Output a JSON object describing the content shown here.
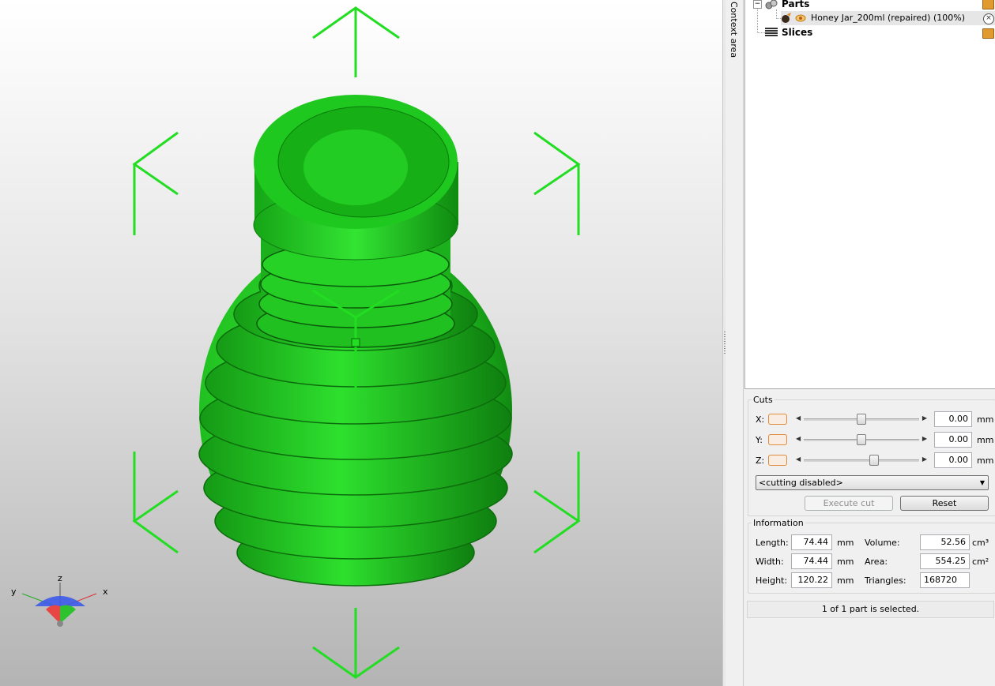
{
  "viewport": {
    "model_color": "#1fc21f",
    "gizmo_color": "#22dd22",
    "axes": {
      "x": "x",
      "y": "y",
      "z": "z"
    }
  },
  "context_area": {
    "label": "Context area"
  },
  "tree": {
    "parts_label": "Parts",
    "part_item": "Honey Jar_200ml (repaired) (100%)",
    "slices_label": "Slices",
    "expander": "−"
  },
  "cuts": {
    "title": "Cuts",
    "rows": [
      {
        "axis": "X:",
        "value": "0.00",
        "unit": "mm",
        "level": 0.5
      },
      {
        "axis": "Y:",
        "value": "0.00",
        "unit": "mm",
        "level": 0.5
      },
      {
        "axis": "Z:",
        "value": "0.00",
        "unit": "mm",
        "level": 0.62
      }
    ],
    "mode": "<cutting disabled>",
    "execute_label": "Execute cut",
    "reset_label": "Reset"
  },
  "information": {
    "title": "Information",
    "length_label": "Length:",
    "length_value": "74.44",
    "length_unit": "mm",
    "width_label": "Width:",
    "width_value": "74.44",
    "width_unit": "mm",
    "height_label": "Height:",
    "height_value": "120.22",
    "height_unit": "mm",
    "volume_label": "Volume:",
    "volume_value": "52.56",
    "volume_unit": "cm³",
    "area_label": "Area:",
    "area_value": "554.25",
    "area_unit": "cm²",
    "triangles_label": "Triangles:",
    "triangles_value": "168720"
  },
  "status": "1 of 1 part is selected."
}
